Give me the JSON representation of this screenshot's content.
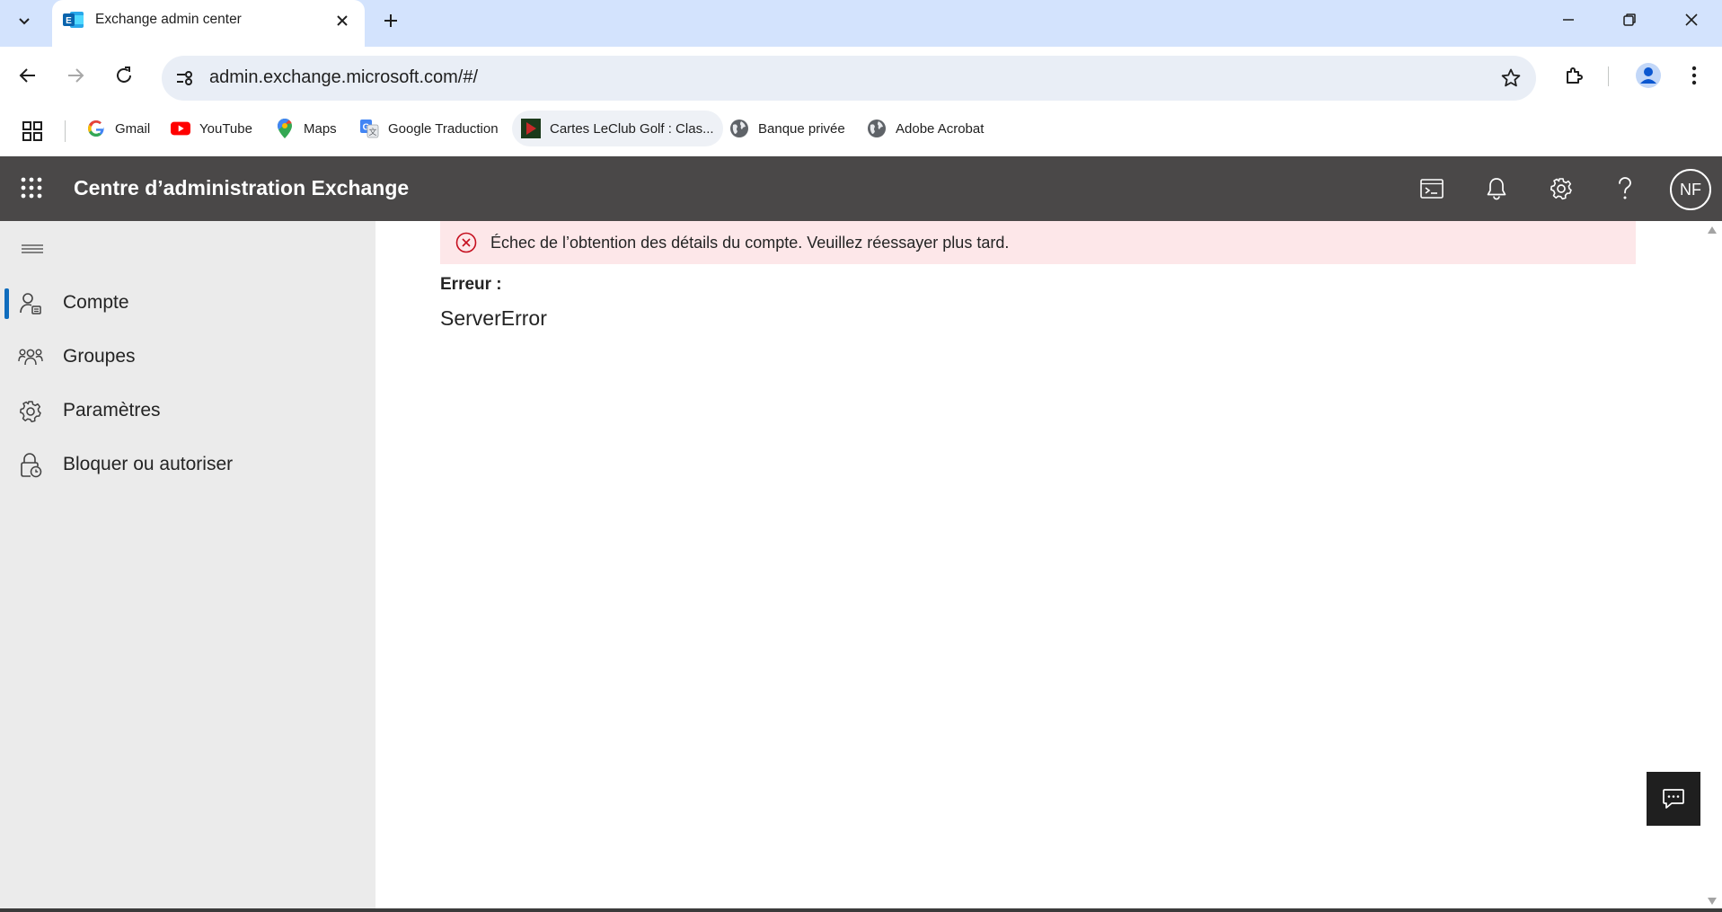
{
  "browser": {
    "tab": {
      "title": "Exchange admin center",
      "favicon": "exchange-icon"
    },
    "address": {
      "url": "admin.exchange.microsoft.com/#/"
    },
    "bookmarks": [
      {
        "label": "Gmail",
        "icon": "google-icon"
      },
      {
        "label": "YouTube",
        "icon": "youtube-icon"
      },
      {
        "label": "Maps",
        "icon": "maps-pin-icon"
      },
      {
        "label": "Google Traduction",
        "icon": "translate-icon"
      },
      {
        "label": "Cartes LeClub Golf : Clas...",
        "icon": "leclub-golf-icon"
      },
      {
        "label": "Banque privée",
        "icon": "globe-icon"
      },
      {
        "label": "Adobe Acrobat",
        "icon": "globe-icon"
      }
    ]
  },
  "suitebar": {
    "title": "Centre d’administration Exchange",
    "avatar_initials": "NF",
    "background": "#4a4848"
  },
  "nav": {
    "items": [
      {
        "label": "Compte",
        "icon": "person-list-icon",
        "active": true
      },
      {
        "label": "Groupes",
        "icon": "people-group-icon",
        "active": false
      },
      {
        "label": "Paramètres",
        "icon": "gear-icon",
        "active": false
      },
      {
        "label": "Bloquer ou autoriser",
        "icon": "lock-clock-icon",
        "active": false
      }
    ],
    "accent": "#0f6cbd"
  },
  "main": {
    "error_banner": {
      "message": "Échec de l’obtention des détails du compte. Veuillez réessayer plus tard.",
      "color": "#fde7e9",
      "icon_color": "#c50f1f"
    },
    "error_label": "Erreur :",
    "error_value": "ServerError"
  }
}
